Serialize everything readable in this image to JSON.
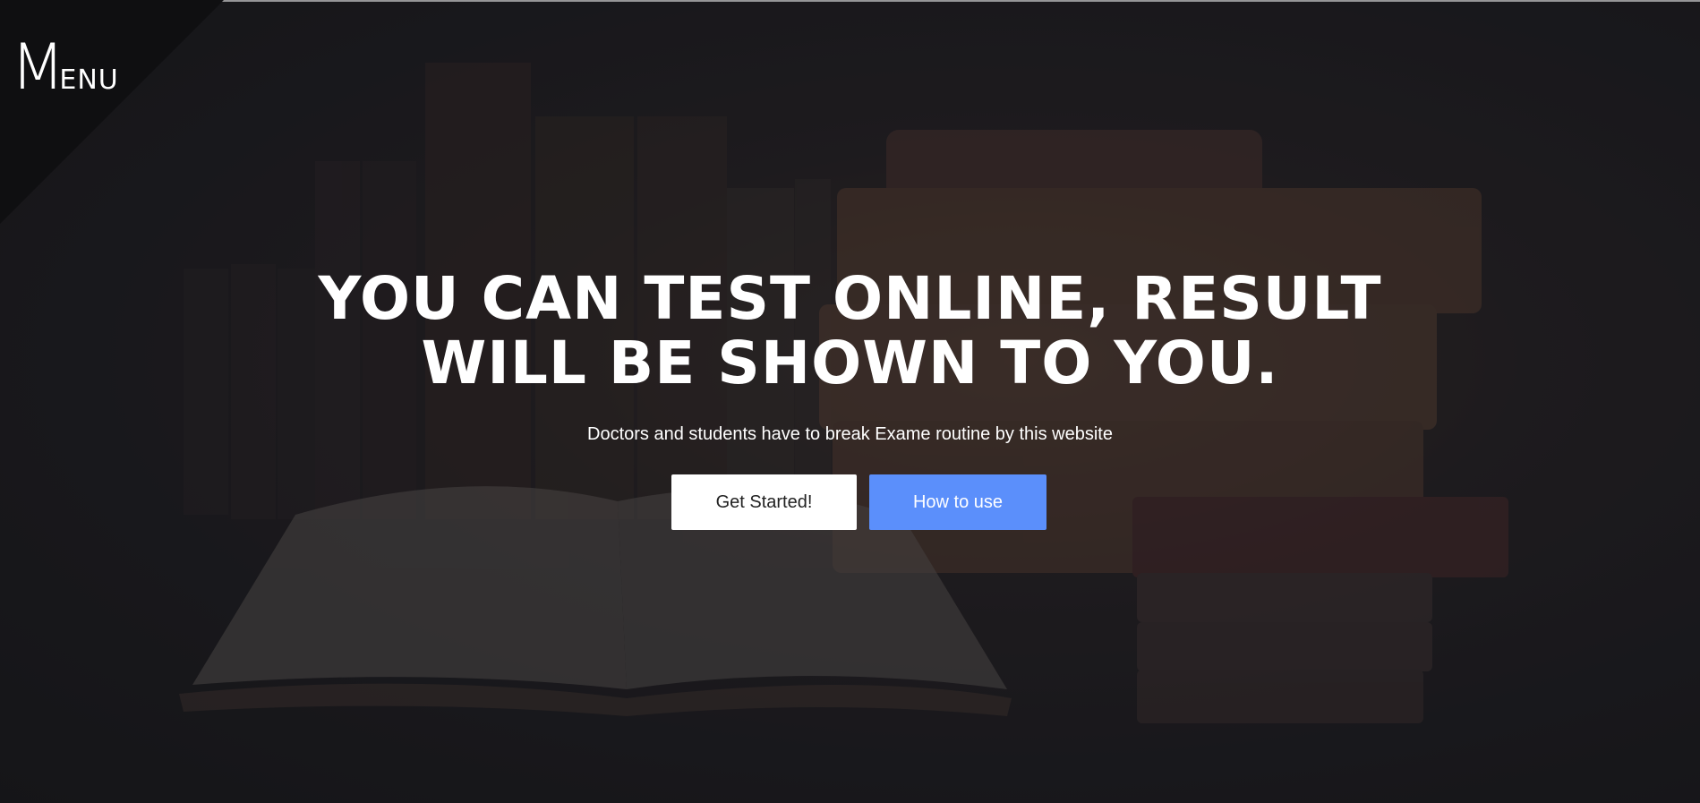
{
  "menu": {
    "initial": "M",
    "rest": "ENU"
  },
  "hero": {
    "title_line1": "YOU CAN TEST ONLINE, RESULT",
    "title_line2": "WILL BE SHOWN TO YOU.",
    "subtitle": "Doctors and students have to break Exame routine by this website"
  },
  "buttons": {
    "get_started": "Get Started!",
    "how_to_use": "How to use"
  },
  "colors": {
    "primary_button": "#5b8ffb",
    "secondary_button": "#ffffff",
    "overlay": "#1c1c1e"
  }
}
